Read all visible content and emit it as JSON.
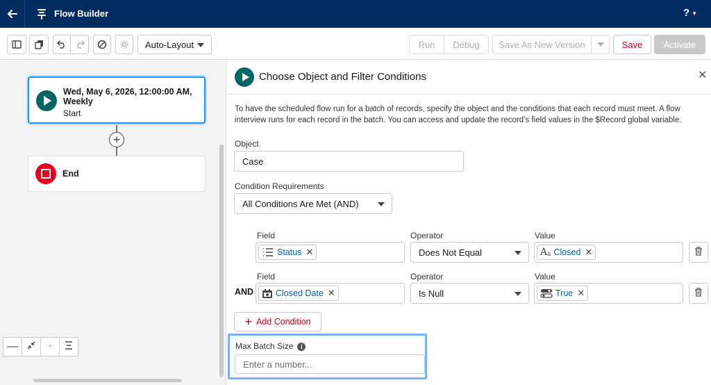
{
  "header": {
    "app_title": "Flow Builder",
    "help_label": "?"
  },
  "toolbar": {
    "layout_select": "Auto-Layout",
    "run_label": "Run",
    "debug_label": "Debug",
    "save_as_new_label": "Save As New Version",
    "save_label": "Save",
    "activate_label": "Activate"
  },
  "canvas": {
    "start_node": {
      "title": "Wed, May 6, 2026, 12:00:00 AM, Weekly",
      "subtitle": "Start"
    },
    "end_node": {
      "title": "End"
    }
  },
  "panel": {
    "title": "Choose Object and Filter Conditions",
    "description": "To have the scheduled flow run for a batch of records, specify the object and the conditions that each record must meet. A flow interview runs for each record in the batch. You can access and update the record’s field values in the $Record global variable.",
    "object_label": "Object",
    "object_value": "Case",
    "condition_req_label": "Condition Requirements",
    "condition_req_value": "All Conditions Are Met (AND)",
    "conditions": [
      {
        "prefix": "",
        "field_label": "Field",
        "field_value": "Status",
        "field_icon": "picklist-icon",
        "operator_label": "Operator",
        "operator_value": "Does Not Equal",
        "value_label": "Value",
        "value_value": "Closed",
        "value_icon": "text-icon"
      },
      {
        "prefix": "AND",
        "field_label": "Field",
        "field_value": "Closed Date",
        "field_icon": "date-icon",
        "operator_label": "Operator",
        "operator_value": "Is Null",
        "value_label": "Value",
        "value_value": "True",
        "value_icon": "toggle-icon"
      }
    ],
    "add_condition_label": "Add Condition",
    "max_batch_label": "Max Batch Size",
    "max_batch_placeholder": "Enter a number..."
  },
  "colors": {
    "header_bg": "#032d60",
    "brand_teal": "#056764",
    "end_red": "#ea001e",
    "link_blue": "#0b5cab",
    "focus_blue": "#78b0fd",
    "save_red": "#ba0517"
  }
}
